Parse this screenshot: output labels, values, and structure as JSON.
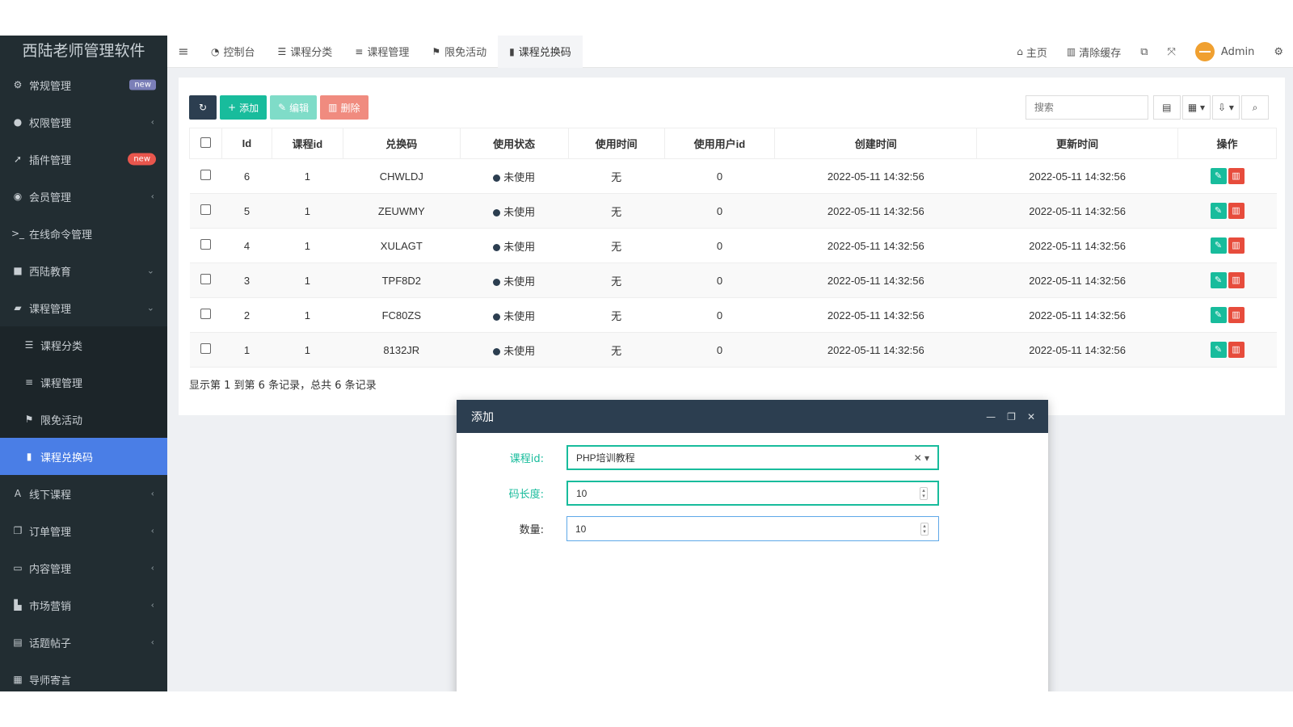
{
  "sidebar": {
    "logo": "西陆老师管理软件",
    "items": [
      {
        "label": "常规管理",
        "icon": "cogs-icon",
        "badge": "new"
      },
      {
        "label": "权限管理",
        "icon": "users-icon"
      },
      {
        "label": "插件管理",
        "icon": "rocket-icon",
        "badge": "new"
      },
      {
        "label": "会员管理",
        "icon": "user-circle-icon"
      },
      {
        "label": "在线命令管理",
        "icon": "terminal-icon"
      },
      {
        "label": "西陆教育",
        "icon": "folder-icon"
      },
      {
        "label": "课程管理",
        "icon": "book-icon"
      },
      {
        "label": "课程分类",
        "icon": "list-alt-icon"
      },
      {
        "label": "课程管理",
        "icon": "list-icon"
      },
      {
        "label": "限免活动",
        "icon": "flag-icon"
      },
      {
        "label": "课程兑换码",
        "icon": "bookmark-icon"
      },
      {
        "label": "线下课程",
        "icon": "font-icon"
      },
      {
        "label": "订单管理",
        "icon": "copy-icon"
      },
      {
        "label": "内容管理",
        "icon": "window-icon"
      },
      {
        "label": "市场营销",
        "icon": "bar-chart-icon"
      },
      {
        "label": "话题帖子",
        "icon": "file-icon"
      },
      {
        "label": "导师寄言",
        "icon": "calendar-icon"
      }
    ]
  },
  "topbar": {
    "tabs": [
      {
        "label": "控制台",
        "icon": "dashboard-icon"
      },
      {
        "label": "课程分类",
        "icon": "list-alt-icon"
      },
      {
        "label": "课程管理",
        "icon": "list-icon"
      },
      {
        "label": "限免活动",
        "icon": "flag-icon"
      },
      {
        "label": "课程兑换码",
        "icon": "bookmark-icon"
      }
    ],
    "home": "主页",
    "clear_cache": "清除缓存",
    "user": "Admin"
  },
  "toolbar": {
    "add": "添加",
    "edit": "编辑",
    "delete": "删除",
    "search_placeholder": "搜索"
  },
  "table": {
    "headers": [
      "Id",
      "课程id",
      "兑换码",
      "使用状态",
      "使用时间",
      "使用用户id",
      "创建时间",
      "更新时间",
      "操作"
    ],
    "rows": [
      {
        "id": "6",
        "course_id": "1",
        "code": "CHWLDJ",
        "status": "未使用",
        "use_time": "无",
        "user_id": "0",
        "created": "2022-05-11 14:32:56",
        "updated": "2022-05-11 14:32:56"
      },
      {
        "id": "5",
        "course_id": "1",
        "code": "ZEUWMY",
        "status": "未使用",
        "use_time": "无",
        "user_id": "0",
        "created": "2022-05-11 14:32:56",
        "updated": "2022-05-11 14:32:56"
      },
      {
        "id": "4",
        "course_id": "1",
        "code": "XULAGT",
        "status": "未使用",
        "use_time": "无",
        "user_id": "0",
        "created": "2022-05-11 14:32:56",
        "updated": "2022-05-11 14:32:56"
      },
      {
        "id": "3",
        "course_id": "1",
        "code": "TPF8D2",
        "status": "未使用",
        "use_time": "无",
        "user_id": "0",
        "created": "2022-05-11 14:32:56",
        "updated": "2022-05-11 14:32:56"
      },
      {
        "id": "2",
        "course_id": "1",
        "code": "FC80ZS",
        "status": "未使用",
        "use_time": "无",
        "user_id": "0",
        "created": "2022-05-11 14:32:56",
        "updated": "2022-05-11 14:32:56"
      },
      {
        "id": "1",
        "course_id": "1",
        "code": "8132JR",
        "status": "未使用",
        "use_time": "无",
        "user_id": "0",
        "created": "2022-05-11 14:32:56",
        "updated": "2022-05-11 14:32:56"
      }
    ],
    "summary": "显示第 1 到第 6 条记录，总共 6 条记录"
  },
  "modal": {
    "title": "添加",
    "fields": [
      {
        "label": "课程id:",
        "value": "PHP培训教程"
      },
      {
        "label": "码长度:",
        "value": "10"
      },
      {
        "label": "数量:",
        "value": "10"
      }
    ]
  }
}
